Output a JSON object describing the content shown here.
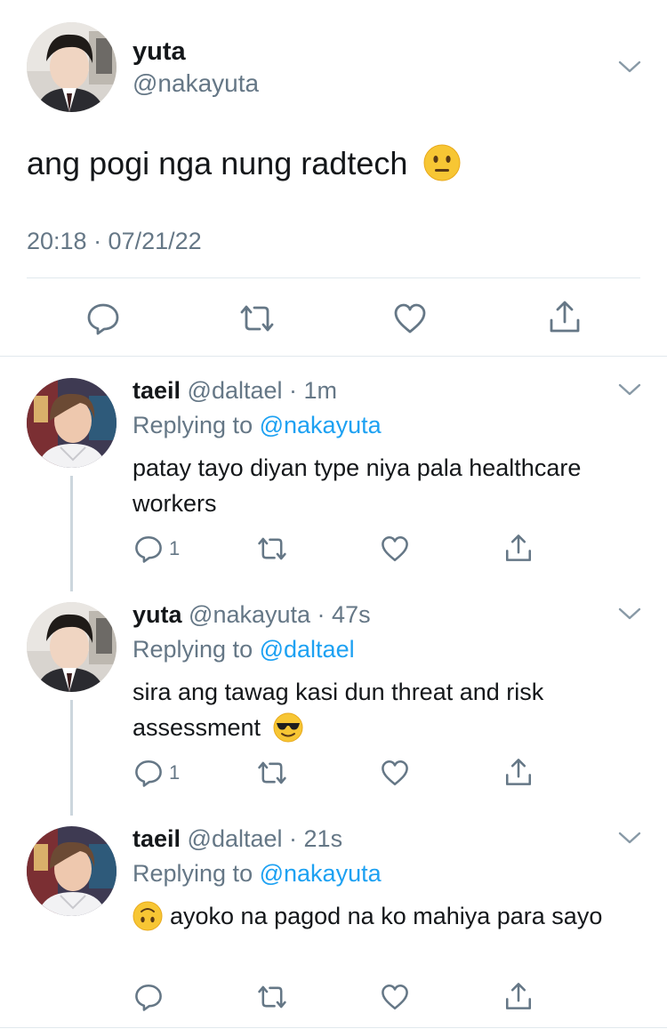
{
  "main_tweet": {
    "name": "yuta",
    "handle": "@nakayuta",
    "text": "ang pogi nga nung radtech",
    "emoji": "neutral-face-emoji",
    "timestamp": "20:18 · 07/21/22"
  },
  "replies": [
    {
      "name": "taeil",
      "handle": "@daltael",
      "time": "1m",
      "replying_prefix": "Replying to",
      "replying_to": "@nakayuta",
      "text": "patay tayo diyan type niya pala healthcare workers",
      "reply_count": "1"
    },
    {
      "name": "yuta",
      "handle": "@nakayuta",
      "time": "47s",
      "replying_prefix": "Replying to",
      "replying_to": "@daltael",
      "text": "sira ang tawag kasi dun threat and risk assessment",
      "emoji": "sunglasses-face-emoji",
      "reply_count": "1"
    },
    {
      "name": "taeil",
      "handle": "@daltael",
      "time": "21s",
      "replying_prefix": "Replying to",
      "replying_to": "@nakayuta",
      "text": "ayoko na pagod na ko mahiya para sayo",
      "emoji": "upside-down-face-emoji",
      "reply_count": ""
    }
  ],
  "colors": {
    "text": "#14171a",
    "secondary": "#657786",
    "link": "#1da1f2",
    "divider": "#e1e8ed",
    "thread_line": "#ccd6dd"
  }
}
